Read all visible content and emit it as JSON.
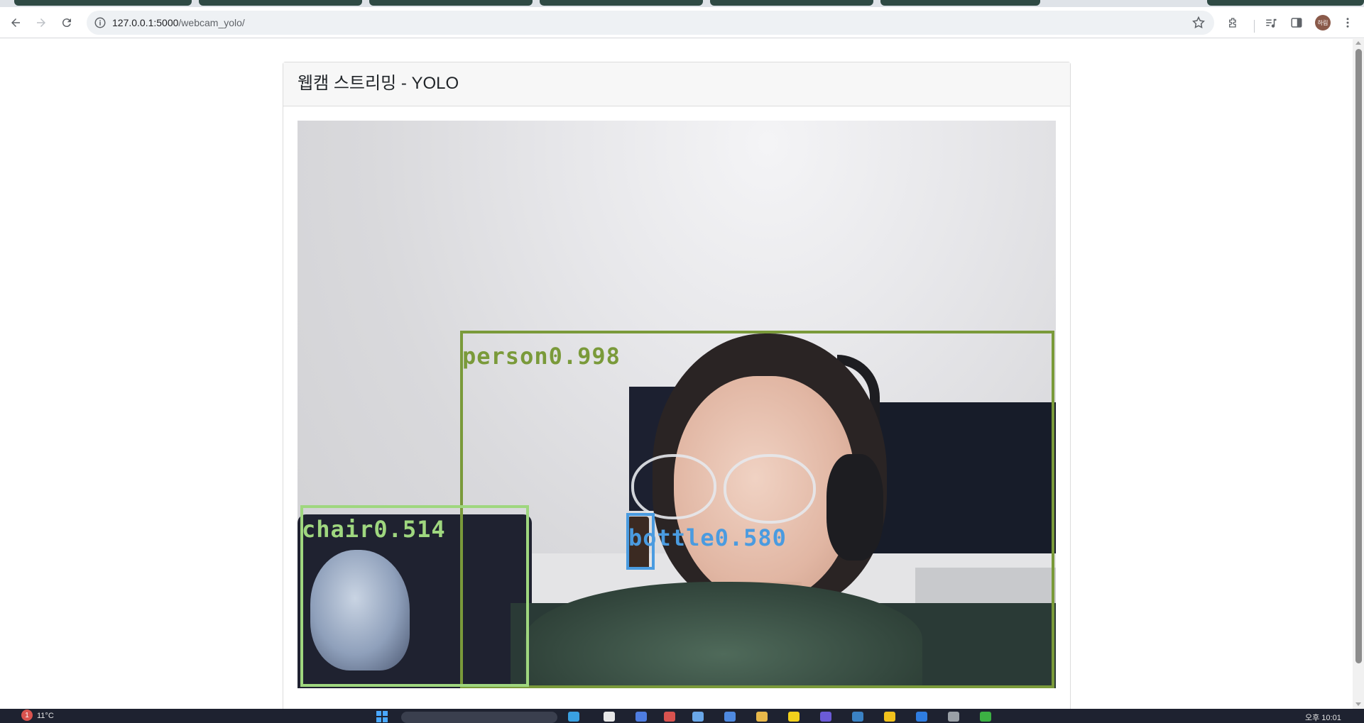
{
  "browser": {
    "url_host": "127.0.0.1:5000",
    "url_path": "/webcam_yolo/",
    "profile_initials": "하림"
  },
  "page": {
    "title": "웹캠 스트리밍 - YOLO",
    "stream_alt": "webcam stream"
  },
  "detections": [
    {
      "label": "person0.998",
      "color": "#7a9a3a"
    },
    {
      "label": "chair0.514",
      "color": "#9fd77f"
    },
    {
      "label": "bottle0.580",
      "color": "#4a9be0"
    }
  ],
  "taskbar": {
    "weather": "11°C",
    "weather_badge": "1",
    "time": "오후 10:01"
  },
  "icons": [
    "back-icon",
    "forward-icon",
    "reload-icon",
    "site-info-icon",
    "bookmark-star-icon",
    "extensions-icon",
    "media-icon",
    "side-panel-icon",
    "menu-icon"
  ]
}
